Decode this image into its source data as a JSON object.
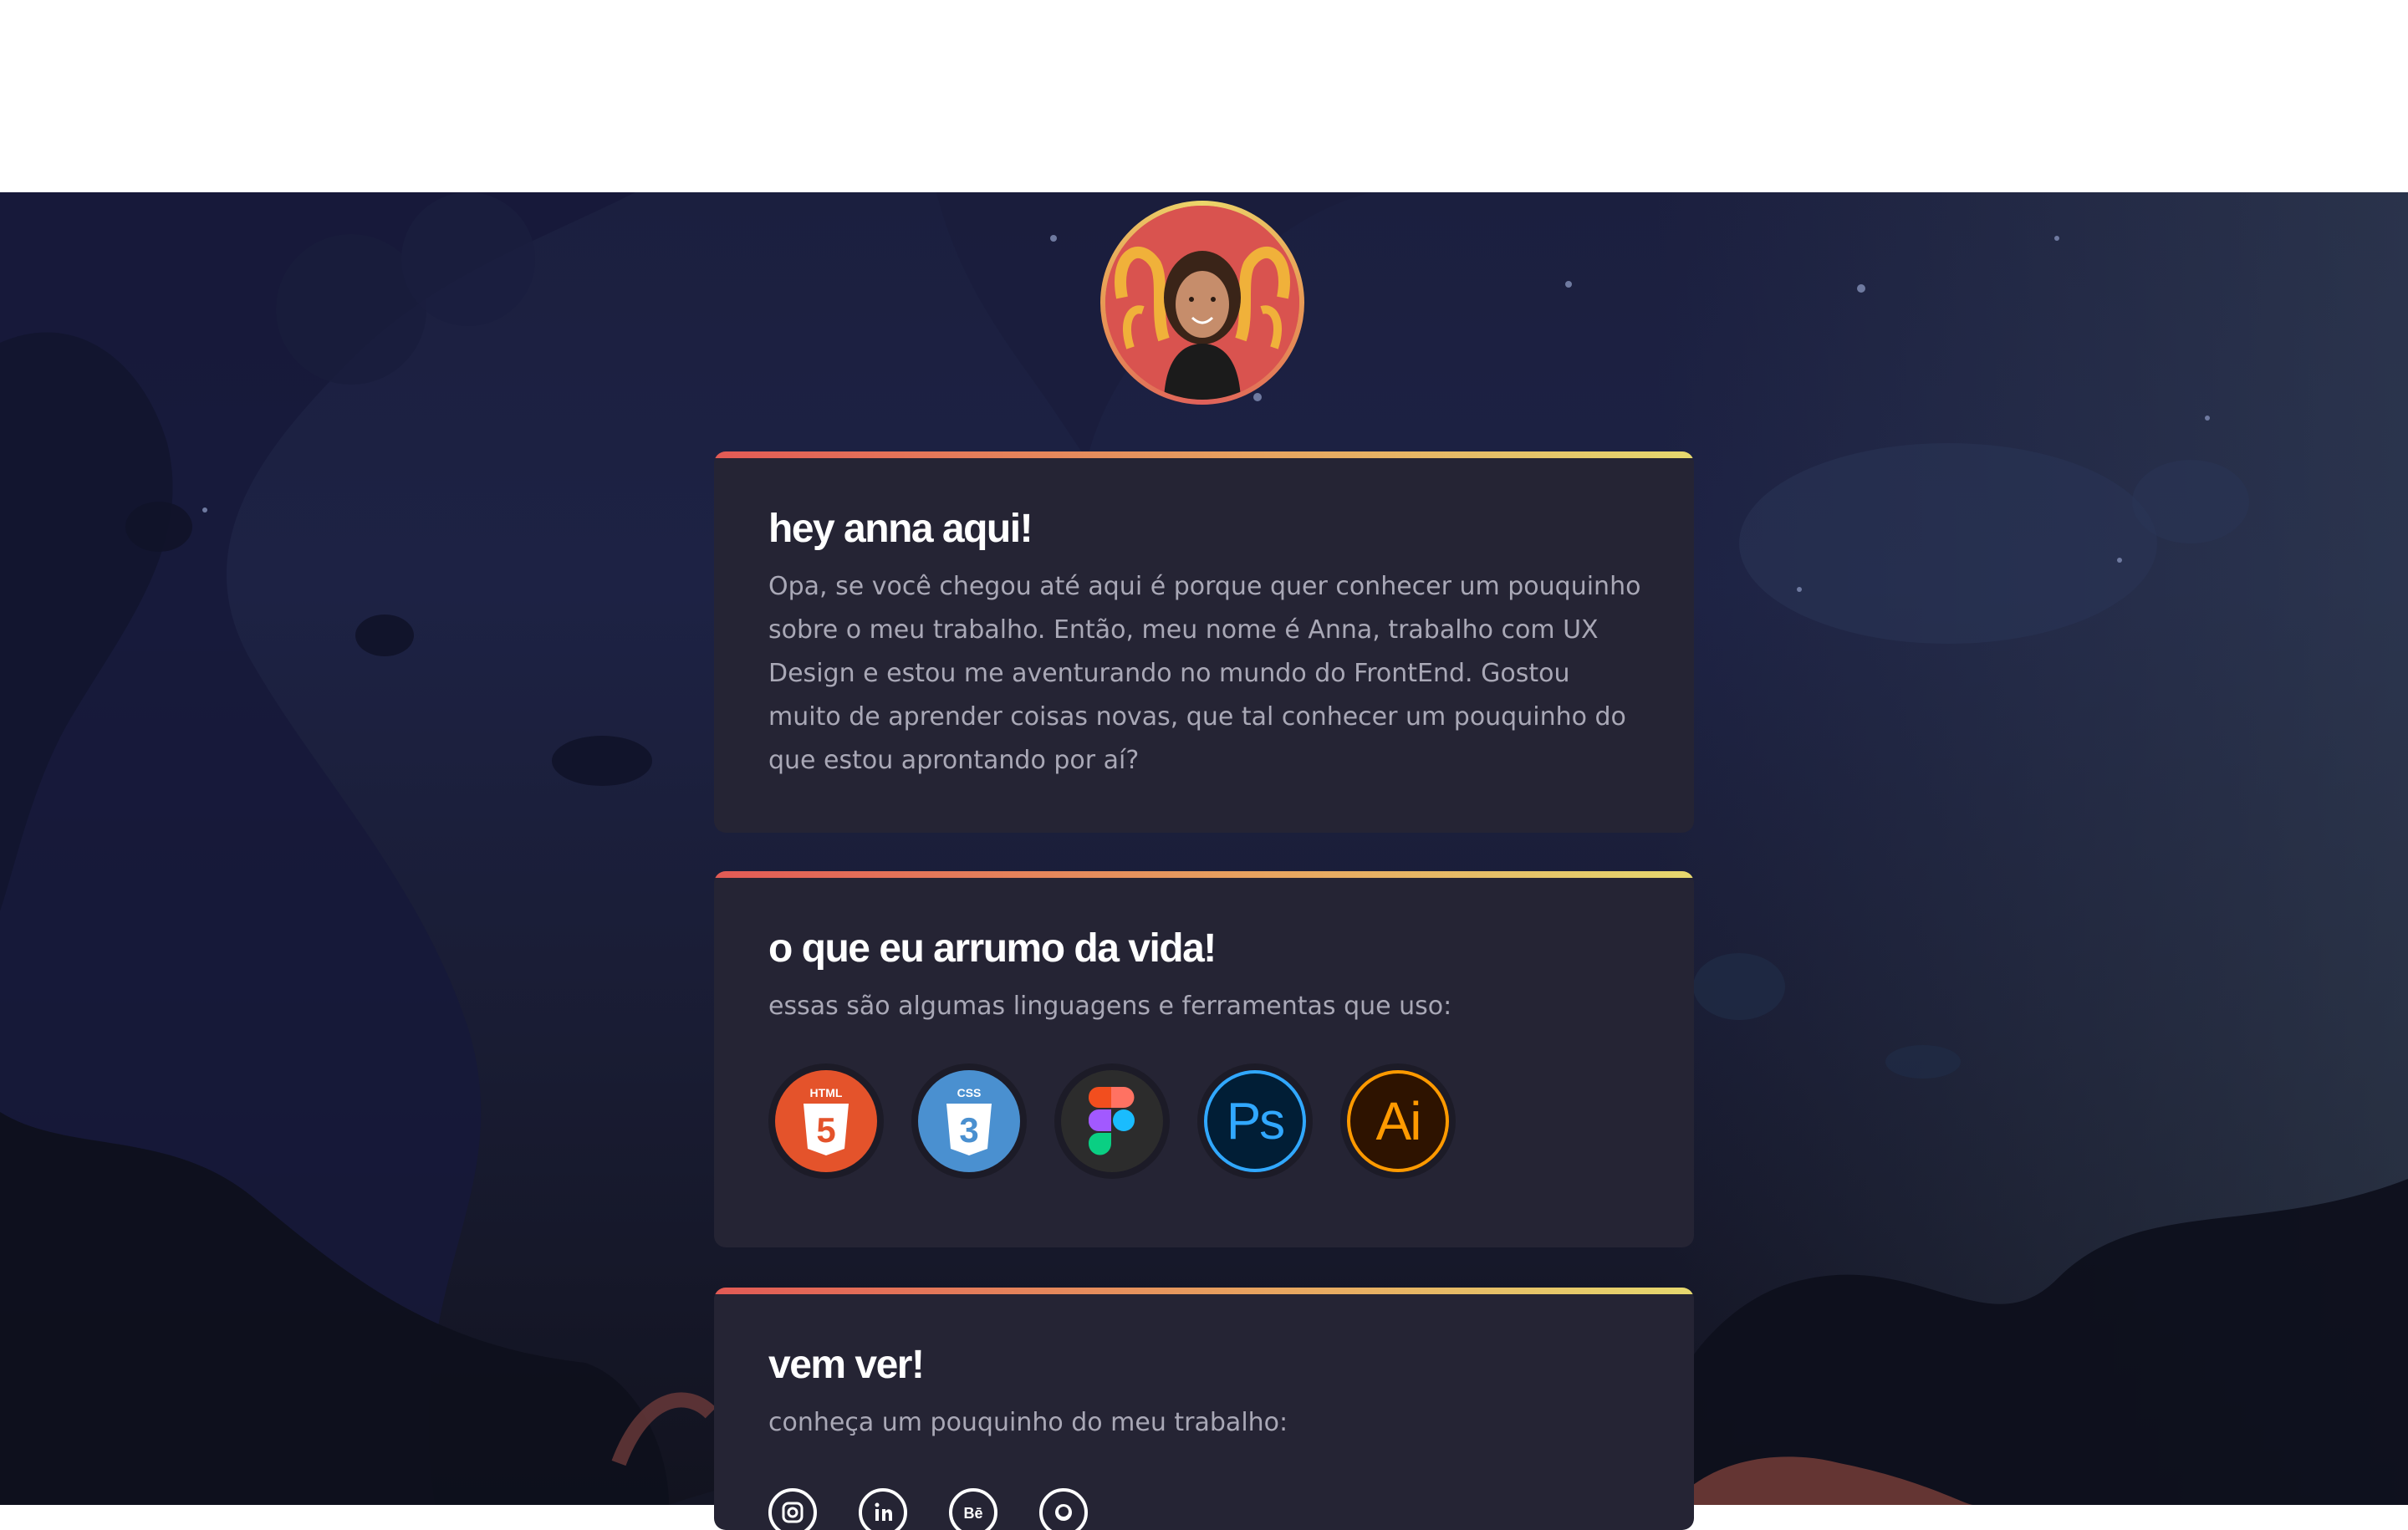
{
  "hero": {
    "avatar_alt": "Anna"
  },
  "about": {
    "title": "hey anna aqui!",
    "text": "Opa, se você chegou até aqui é porque quer conhecer um pouquinho sobre o meu trabalho. Então, meu nome é Anna, trabalho com UX Design e estou me aventurando no mundo do FrontEnd. Gostou muito de aprender coisas novas, que tal conhecer um pouquinho do que estou aprontando por aí?"
  },
  "skills": {
    "title": "o que eu arrumo da vida!",
    "subtitle": "essas são algumas linguagens e ferramentas que uso:",
    "tools": [
      {
        "name": "html5-icon",
        "label": "HTML",
        "glyph": "5",
        "color": "#e4532b"
      },
      {
        "name": "css3-icon",
        "label": "CSS",
        "glyph": "3",
        "color": "#4a90d0"
      },
      {
        "name": "figma-icon",
        "label": "",
        "glyph": "",
        "color": "#2c2c2c"
      },
      {
        "name": "photoshop-icon",
        "label": "",
        "glyph": "Ps",
        "color": "#011e36"
      },
      {
        "name": "illustrator-icon",
        "label": "",
        "glyph": "Ai",
        "color": "#2e1300"
      }
    ]
  },
  "work": {
    "title": "vem ver!",
    "subtitle": "conheça um pouquinho do meu trabalho:",
    "socials": [
      "instagram-icon",
      "linkedin-icon",
      "behance-icon",
      "github-icon"
    ]
  },
  "colors": {
    "card_bg": "#252434",
    "accent_start": "#e25a55",
    "accent_end": "#e6d86e",
    "text_muted": "#a9a8b6"
  }
}
